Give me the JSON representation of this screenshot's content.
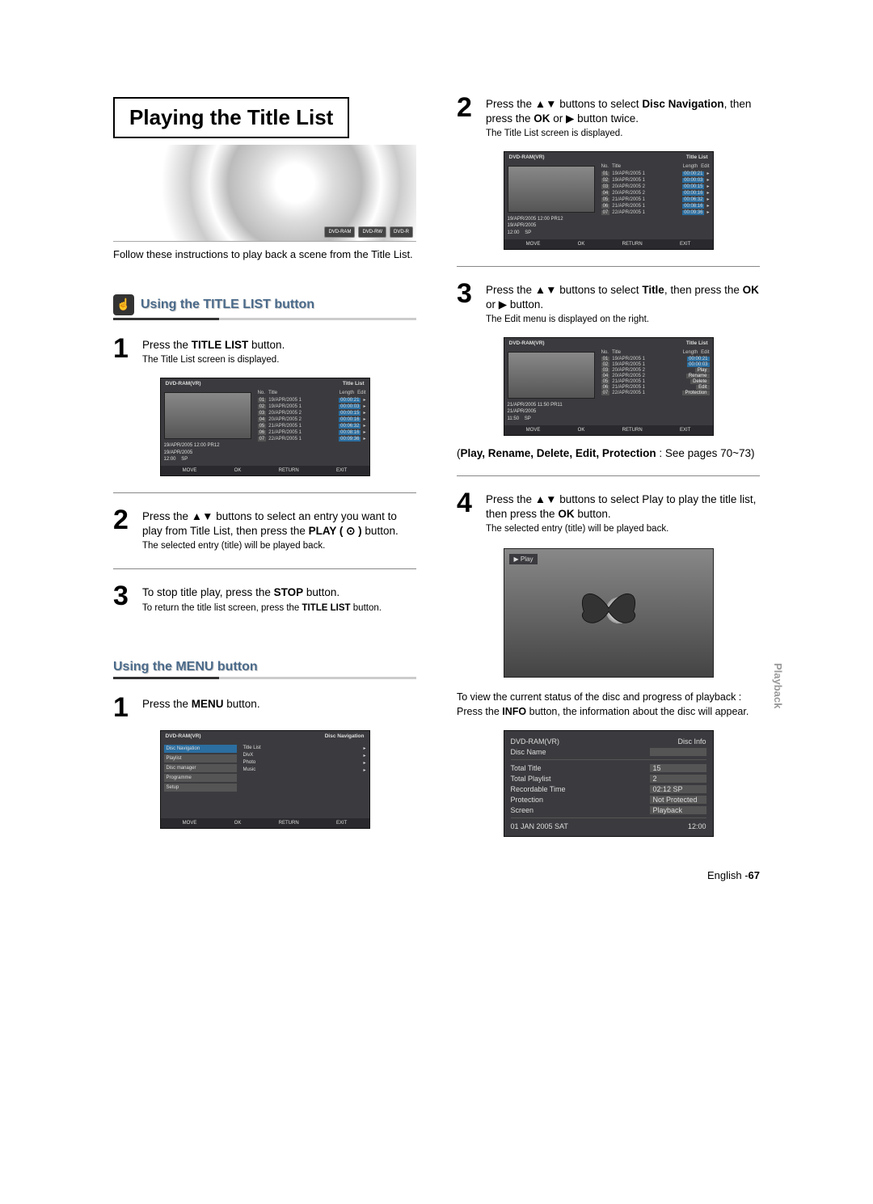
{
  "header": {
    "title": "Playing the Title List",
    "badges": [
      "DVD-RAM",
      "DVD-RW",
      "DVD-R"
    ],
    "intro": "Follow these instructions to play back a scene from the Title List."
  },
  "left": {
    "section1": {
      "title": "Using the TITLE LIST button",
      "steps": [
        {
          "num": "1",
          "text_a": "Press the ",
          "b1": "TITLE LIST",
          "text_b": " button.",
          "sub": "The Title List screen is displayed."
        },
        {
          "num": "2",
          "text": "Press the ▲▼ buttons to select an entry you want to play from Title List, then press the ",
          "b1": "PLAY ( ⊙ )",
          "text_b": " button.",
          "sub": "The selected entry (title) will be played back."
        },
        {
          "num": "3",
          "text_a": "To stop title play, press the ",
          "b1": "STOP",
          "text_b": " button.",
          "sub_a": "To return the title list screen, press the ",
          "sub_b": "TITLE LIST",
          "sub_c": " button."
        }
      ]
    },
    "section2": {
      "title": "Using the MENU button",
      "step": {
        "num": "1",
        "text_a": "Press the ",
        "b1": "MENU",
        "text_b": " button."
      }
    }
  },
  "right": {
    "steps": [
      {
        "num": "2",
        "text_a": "Press the ▲▼ buttons to select ",
        "b1": "Disc Navigation",
        "text_b": ", then press the ",
        "b2": "OK",
        "text_c": " or ▶ button twice.",
        "sub": "The Title List screen is displayed."
      },
      {
        "num": "3",
        "text_a": "Press the ▲▼ buttons to select ",
        "b1": "Title",
        "text_b": ", then press the ",
        "b2": "OK",
        "text_c": " or ▶ button.",
        "sub": "The Edit menu is displayed on the right."
      },
      {
        "num": "4",
        "text_a": "Press the ▲▼ buttons to select Play to play the title list, then press the ",
        "b1": "OK",
        "text_b": " button.",
        "sub": "The selected entry (title) will be played back."
      }
    ],
    "seeref_a": "(",
    "seeref_b": "Play, Rename, Delete, Edit, Protection",
    "seeref_c": " : See pages 70~73)",
    "status_text": "To view the current status of the disc and progress of playback : Press the ",
    "status_b": "INFO",
    "status_text2": " button, the information about the disc will appear."
  },
  "osd": {
    "disc_label": "DVD-RAM(VR)",
    "title_list": "Title List",
    "disc_nav": "Disc Navigation",
    "cols": {
      "no": "No.",
      "title": "Title",
      "length": "Length",
      "edit": "Edit"
    },
    "thumb1": {
      "l1": "19/APR/2005 12:00 PR12",
      "l2": "19/APR/2005",
      "l3": "12:00",
      "sp": "SP"
    },
    "thumb2": {
      "l1": "21/APR/2005 11:50 PR11",
      "l2": "21/APR/2005",
      "l3": "11:50",
      "sp": "SP"
    },
    "rows": [
      {
        "n": "01",
        "t": "19/APR/2005 1",
        "l": "00:00:21"
      },
      {
        "n": "02",
        "t": "19/APR/2005 1",
        "l": "00:00:03"
      },
      {
        "n": "03",
        "t": "20/APR/2005 2",
        "l": "00:00:15"
      },
      {
        "n": "04",
        "t": "20/APR/2005 2",
        "l": "00:00:16"
      },
      {
        "n": "05",
        "t": "21/APR/2005 1",
        "l": "00:06:32"
      },
      {
        "n": "06",
        "t": "21/APR/2005 1",
        "l": "00:08:16"
      },
      {
        "n": "07",
        "t": "22/APR/2005 1",
        "l": "00:09:36"
      }
    ],
    "edit_menu": [
      "Play",
      "Rename",
      "Delete",
      "Edit",
      "Protection"
    ],
    "foot": {
      "move": "MOVE",
      "ok": "OK",
      "return": "RETURN",
      "exit": "EXIT"
    },
    "nav_items": [
      "Disc Navigation",
      "Playlist",
      "Disc manager",
      "Programme",
      "Setup"
    ],
    "nav_sub": [
      "Title List",
      "DivX",
      "Photo",
      "Music"
    ],
    "play_chip": "▶ Play"
  },
  "info": {
    "hdr_l": "DVD-RAM(VR)",
    "hdr_r": "Disc Info",
    "rows": [
      {
        "k": "Disc Name",
        "v": ""
      },
      {
        "k": "Total Title",
        "v": "15"
      },
      {
        "k": "Total Playlist",
        "v": "2"
      },
      {
        "k": "Recordable Time",
        "v": "02:12  SP"
      },
      {
        "k": "Protection",
        "v": "Not Protected"
      },
      {
        "k": "Screen",
        "v": "Playback"
      }
    ],
    "foot_l": "01 JAN 2005 SAT",
    "foot_r": "12:00"
  },
  "chrome": {
    "side": "Playback",
    "foot_a": "English -",
    "foot_b": "67"
  }
}
